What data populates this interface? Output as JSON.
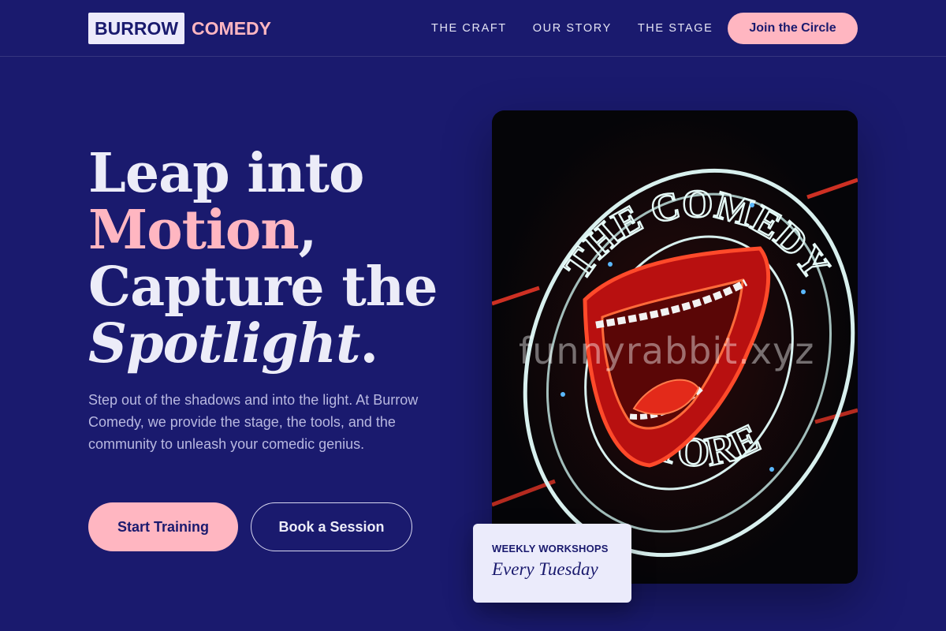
{
  "brand": {
    "logo_box": "BURROW",
    "logo_word": "COMEDY"
  },
  "nav": {
    "links": [
      "THE CRAFT",
      "OUR STORY",
      "THE STAGE"
    ],
    "cta": "Join the Circle"
  },
  "hero": {
    "line1": "Leap into",
    "line2_highlight": "Motion",
    "line2_rest": ",",
    "line3": "Capture the",
    "line4_italic": "Spotlight",
    "line4_rest": ".",
    "subtitle": "Step out of the shadows and into the light. At Burrow Comedy, we provide the stage, the tools, and the community to unleash your comedic genius.",
    "primary_button": "Start Training",
    "secondary_button": "Book a Session"
  },
  "image": {
    "sign_top_text": "THE COMEDY",
    "sign_bottom_text": "STORE",
    "watermark": "funnyrabbit.xyz"
  },
  "workshop_card": {
    "label": "WEEKLY WORKSHOPS",
    "day": "Every Tuesday"
  },
  "colors": {
    "background": "#1a1a6e",
    "accent": "#ffb6c1",
    "card": "#ebebfb"
  }
}
